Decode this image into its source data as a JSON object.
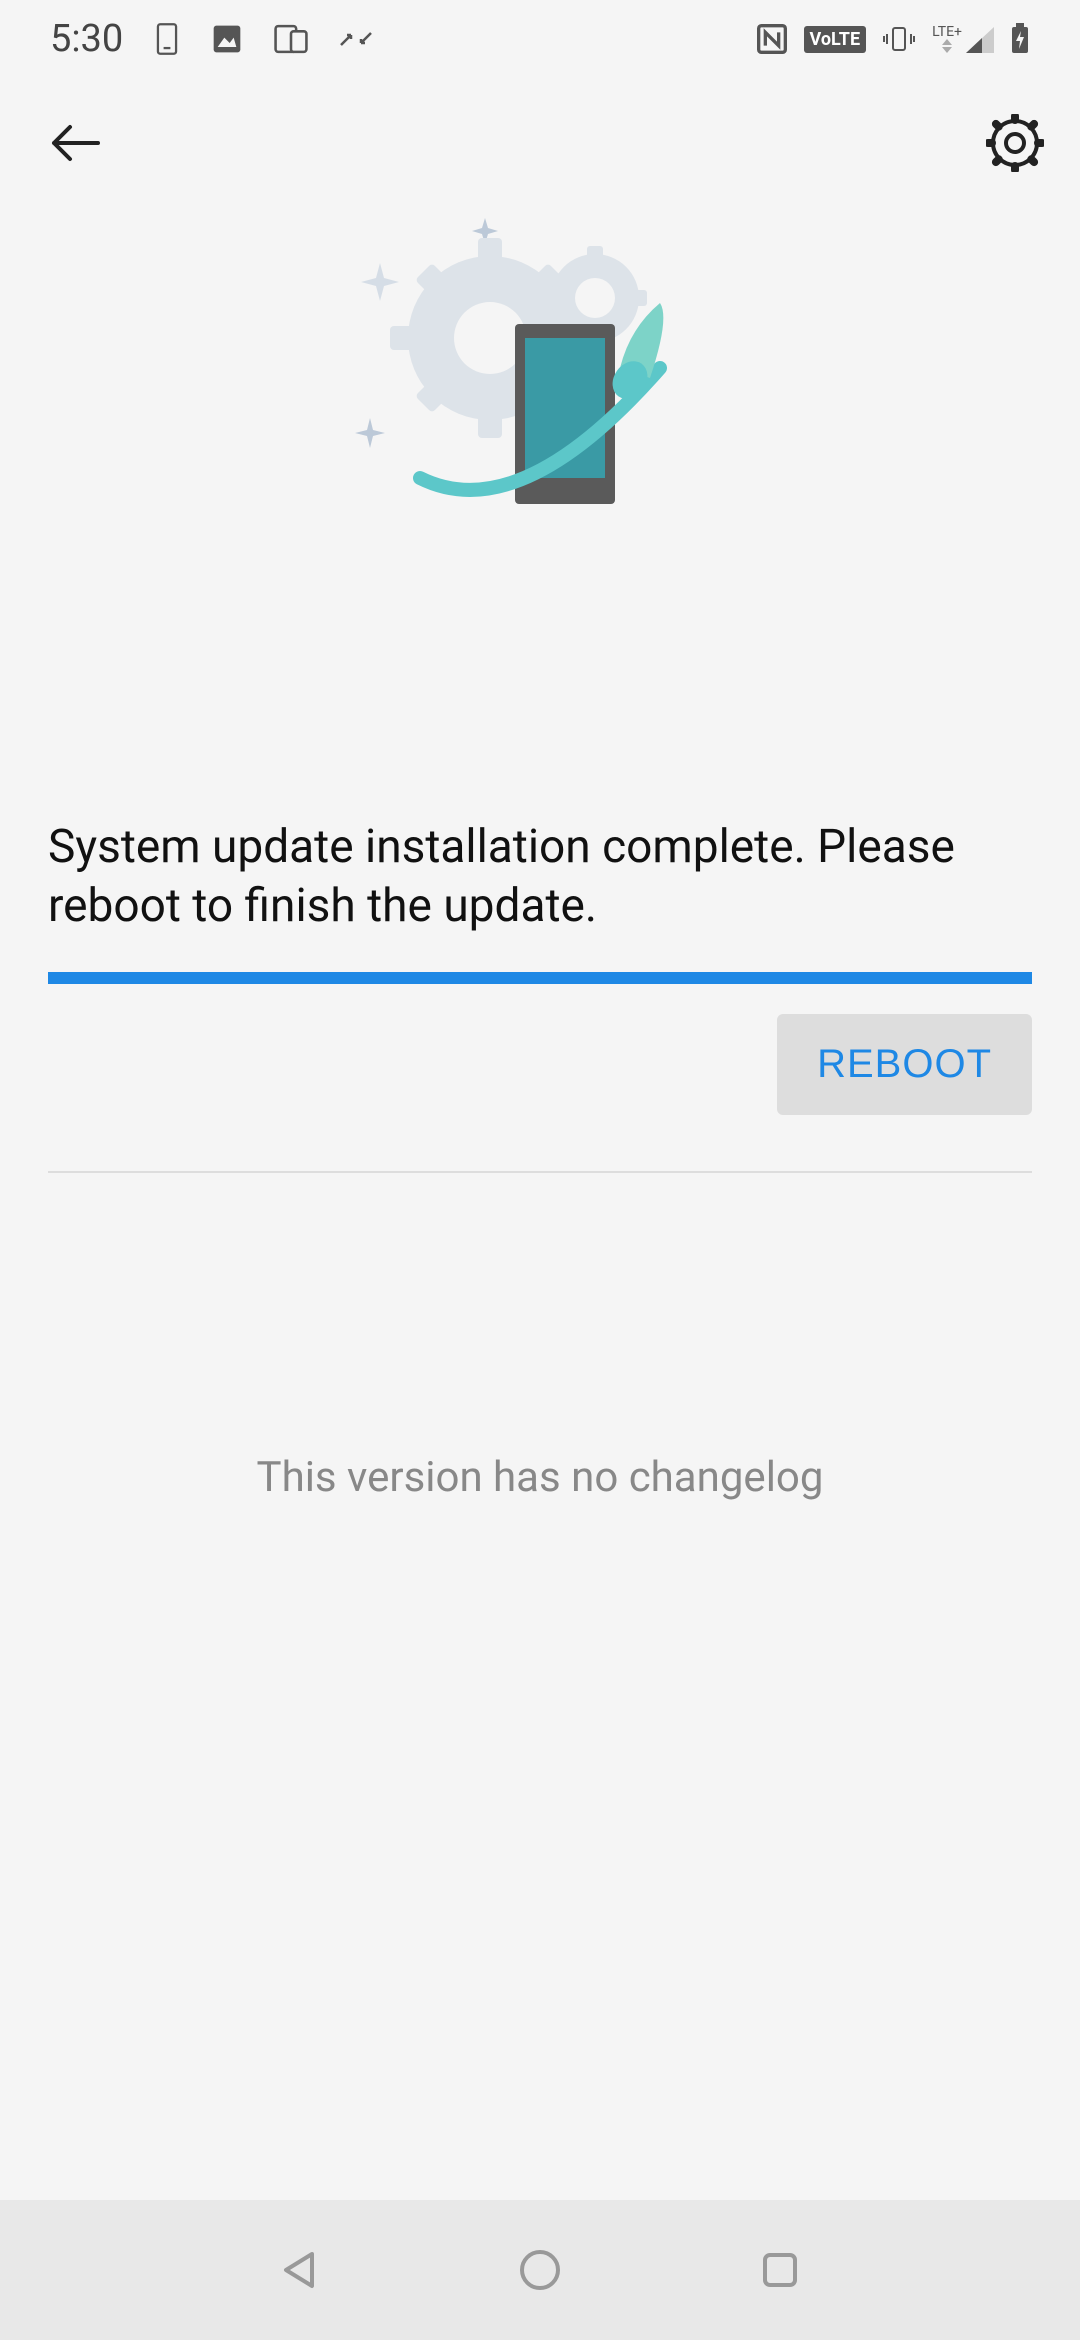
{
  "status_bar": {
    "time": "5:30",
    "left_icons": [
      "phone-lock-icon",
      "image-icon",
      "devices-icon",
      "collapse-icon"
    ],
    "right_icons": [
      "nfc-icon",
      "volte-badge",
      "vibrate-icon",
      "lte-signal-icon",
      "battery-charging-icon"
    ],
    "volte_label": "VoLTE",
    "network_label": "LTE+"
  },
  "header": {
    "back_icon": "arrow-back",
    "settings_icon": "gear"
  },
  "main": {
    "message": "System update installation complete. Please reboot to finish the update.",
    "progress_percent": 100,
    "reboot_label": "REBOOT",
    "changelog_text": "This version has no changelog"
  },
  "colors": {
    "accent": "#1e88e5",
    "text_primary": "#111",
    "text_secondary": "#888",
    "button_bg": "#ddd"
  },
  "nav": {
    "back_icon": "triangle-back",
    "home_icon": "circle-home",
    "recent_icon": "square-recent"
  }
}
